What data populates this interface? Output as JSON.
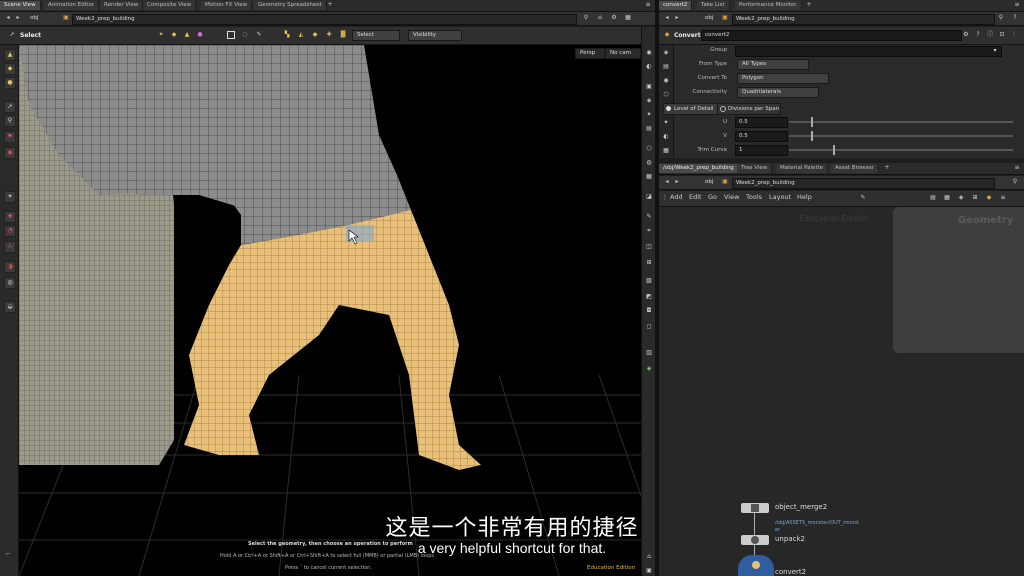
{
  "viewport_panel": {
    "tabs": [
      "Scene View",
      "Animation Editor",
      "Render View",
      "Composite View",
      "Motion FX View",
      "Geometry Spreadsheet"
    ],
    "path": {
      "root": "obj",
      "node": "Week2_prep_building"
    },
    "toolbar": {
      "mode_label": "Select",
      "select_dropdown": "Select",
      "visibility_dropdown": "Visibility"
    },
    "camera": {
      "view": "Persp",
      "cam": "No cam"
    },
    "status": {
      "line1": "Select the geometry, then choose an operation to perform",
      "line2": "Hold A or Ctrl+A or Shift+A or Ctrl+Shift+A to select full (MMB) or partial (LMB) loops",
      "line3": "Press ` to cancel current selection."
    },
    "watermark": "Education Edition"
  },
  "parm_panel": {
    "tabs": [
      "convert2",
      "Take List",
      "Performance Monitor"
    ],
    "path": {
      "root": "obj",
      "node": "Week2_prep_building"
    },
    "node_type": "Convert",
    "node_name": "convert2",
    "params": {
      "group_label": "Group",
      "group_value": "",
      "from_type_label": "From Type",
      "from_type_value": "All Types",
      "convert_to_label": "Convert To",
      "convert_to_value": "Polygon",
      "connectivity_label": "Connectivity",
      "connectivity_value": "Quadrilaterals",
      "lod_label": "Level of Detail",
      "divisions_label": "Divisions per Span",
      "u_label": "U",
      "u_value": "0.5",
      "v_label": "V",
      "v_value": "0.5",
      "trim_label": "Trim Curve",
      "trim_value": "1"
    }
  },
  "network_panel": {
    "tabs": [
      "/obj/Week2_prep_building",
      "Tree View",
      "Material Palette",
      "Asset Browser"
    ],
    "path": {
      "root": "obj",
      "node": "Week2_prep_building"
    },
    "menu": [
      "Add",
      "Edit",
      "Go",
      "View",
      "Tools",
      "Layout",
      "Help"
    ],
    "watermark": "Education Edition",
    "context_label": "Geometry",
    "nodes": [
      {
        "name": "object_merge2",
        "sub": "/obj/ASSETS_monster/OUT_monst",
        "sub2": "er"
      },
      {
        "name": "unpack2"
      },
      {
        "name": "convert2"
      }
    ]
  },
  "subtitles": {
    "zh": "这是一个非常有用的捷径",
    "en": "a very helpful shortcut for that."
  }
}
